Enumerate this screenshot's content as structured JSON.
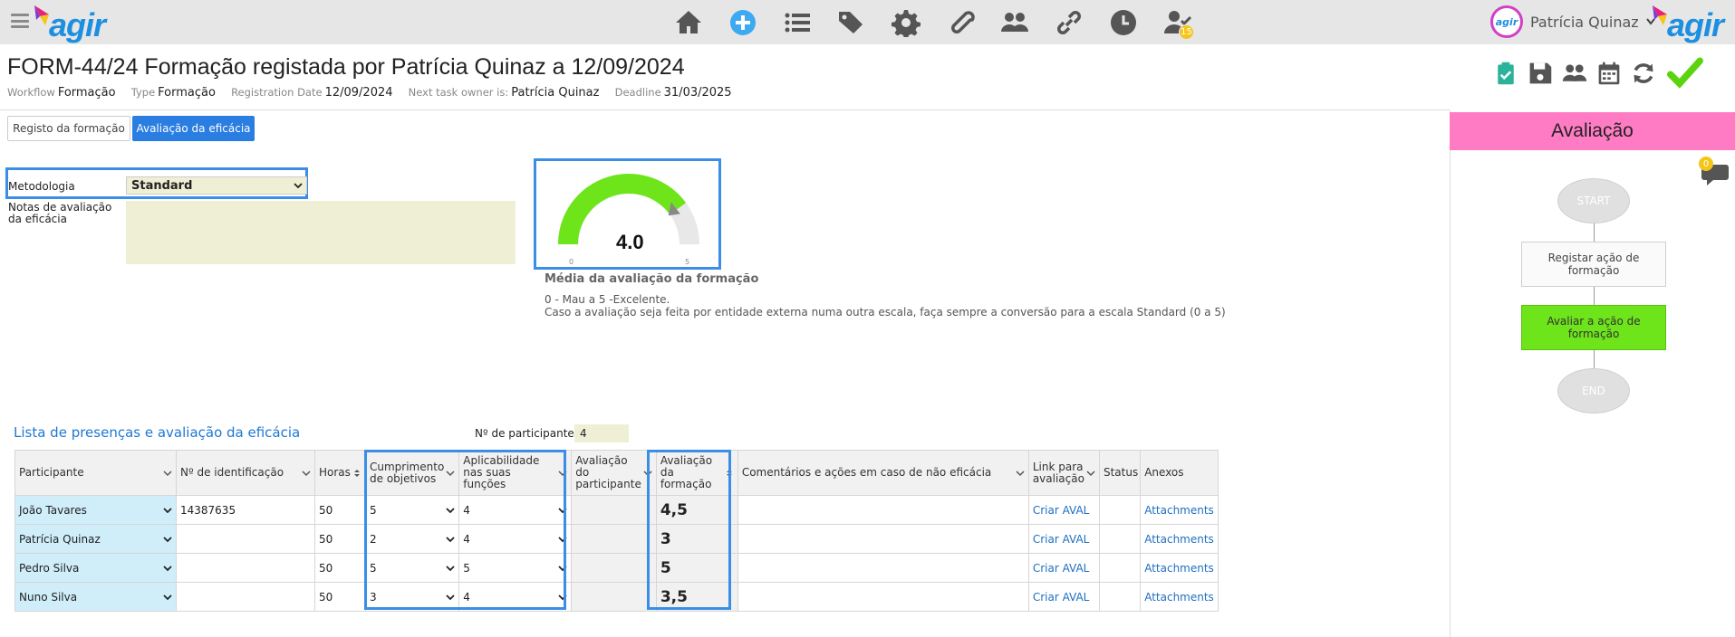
{
  "app": {
    "logo_text": "agir",
    "user_name": "Patrícia Quinaz",
    "task_badge": "15"
  },
  "header": {
    "title": "FORM-44/24 Formação registada por Patrícia Quinaz a 12/09/2024",
    "meta": [
      {
        "key": "Workflow",
        "value": "Formação"
      },
      {
        "key": "Type",
        "value": "Formação"
      },
      {
        "key": "Registration Date",
        "value": "12/09/2024"
      },
      {
        "key": "Next task owner is:",
        "value": "Patrícia Quinaz"
      },
      {
        "key": "Deadline",
        "value": "31/03/2025"
      }
    ]
  },
  "tabs": [
    {
      "label": "Registo da formação",
      "active": false
    },
    {
      "label": "Avaliação da eficácia",
      "active": true
    }
  ],
  "form": {
    "metodologia_label": "Metodologia",
    "metodologia_value": "Standard",
    "notas_label": "Notas de avaliação da eficácia",
    "notas_value": ""
  },
  "gauge": {
    "value": 4.0,
    "value_label": "4.0",
    "min": 0,
    "max": 5,
    "min_label": "0",
    "max_label": "5",
    "title": "Média da avaliação da formação",
    "desc1": "0 - Mau a 5 -Excelente.",
    "desc2": "Caso a avaliação seja feita por entidade externa numa outra escala, faça sempre a conversão para a escala Standard (0 a 5)",
    "color": "#6ee41a"
  },
  "list": {
    "title": "Lista de presenças e avaliação da eficácia",
    "participants_label": "Nº de participantes",
    "participants_value": "4",
    "columns": [
      "Participante",
      "Nº de identificação",
      "Horas",
      "Cumprimento de objetivos",
      "Aplicabilidade nas suas funções",
      "Avaliação do participante",
      "Avaliação da formação",
      "Comentários e ações em caso de não eficácia",
      "Link para avaliação",
      "Status",
      "Anexos"
    ],
    "rows": [
      {
        "participante": "João Tavares",
        "id": "14387635",
        "horas": "50",
        "cumprimento": "5",
        "aplicabilidade": "4",
        "aval_part": "",
        "aval_form": "4,5",
        "comentarios": "",
        "link": "Criar AVAL",
        "status": "",
        "anexos": "Attachments"
      },
      {
        "participante": "Patrícia Quinaz",
        "id": "",
        "horas": "50",
        "cumprimento": "2",
        "aplicabilidade": "4",
        "aval_part": "",
        "aval_form": "3",
        "comentarios": "",
        "link": "Criar AVAL",
        "status": "",
        "anexos": "Attachments"
      },
      {
        "participante": "Pedro Silva",
        "id": "",
        "horas": "50",
        "cumprimento": "5",
        "aplicabilidade": "5",
        "aval_part": "",
        "aval_form": "5",
        "comentarios": "",
        "link": "Criar AVAL",
        "status": "",
        "anexos": "Attachments"
      },
      {
        "participante": "Nuno Silva",
        "id": "",
        "horas": "50",
        "cumprimento": "3",
        "aplicabilidade": "4",
        "aval_part": "",
        "aval_form": "3,5",
        "comentarios": "",
        "link": "Criar AVAL",
        "status": "",
        "anexos": "Attachments"
      }
    ]
  },
  "side": {
    "title": "Avaliação",
    "chat_badge": "0",
    "workflow": {
      "start": "START",
      "step1": "Registar ação de formação",
      "step2": "Avaliar a ação de formação",
      "end": "END"
    }
  }
}
